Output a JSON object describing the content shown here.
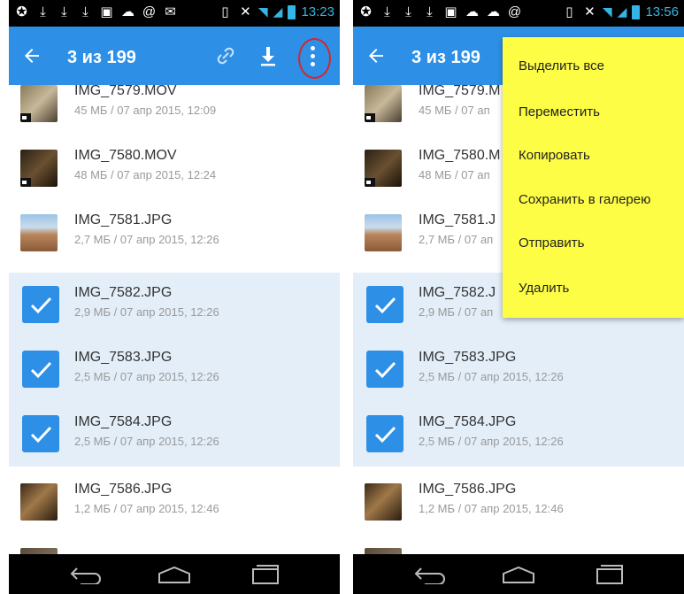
{
  "statusbar": {
    "left": {
      "icons": [
        "settings-icon",
        "download-icon",
        "download-icon",
        "download-icon",
        "image-icon",
        "cloud-icon",
        "at-icon",
        "mail-icon"
      ]
    },
    "right": {
      "icons": [
        "vibrate-icon",
        "no-sound-icon",
        "wifi-icon",
        "signal-icon",
        "battery-icon"
      ]
    },
    "time_left": "13:23",
    "time_right": "13:56"
  },
  "appbar": {
    "counter": "3 из 199",
    "accent": "#2d90e6",
    "highlight_ring": "#d6262a"
  },
  "files": [
    {
      "name": "IMG_7579.MOV",
      "meta": "45 МБ / 07 апр 2015, 12:09",
      "selected": false,
      "video": true
    },
    {
      "name": "IMG_7580.MOV",
      "meta": "48 МБ / 07 апр 2015, 12:24",
      "selected": false,
      "video": true
    },
    {
      "name": "IMG_7581.JPG",
      "meta": "2,7 МБ / 07 апр 2015, 12:26",
      "selected": false,
      "video": false
    },
    {
      "name": "IMG_7582.JPG",
      "meta": "2,9 МБ / 07 апр 2015, 12:26",
      "selected": true,
      "video": false
    },
    {
      "name": "IMG_7583.JPG",
      "meta": "2,5 МБ / 07 апр 2015, 12:26",
      "selected": true,
      "video": false
    },
    {
      "name": "IMG_7584.JPG",
      "meta": "2,5 МБ / 07 апр 2015, 12:26",
      "selected": true,
      "video": false
    },
    {
      "name": "IMG_7586.JPG",
      "meta": "1,2 МБ / 07 апр 2015, 12:46",
      "selected": false,
      "video": false
    }
  ],
  "right_files": [
    {
      "name": "IMG_7579.M",
      "meta": "45 МБ / 07 ап",
      "selected": false,
      "video": true
    },
    {
      "name": "IMG_7580.M",
      "meta": "48 МБ / 07 ап",
      "selected": false,
      "video": true
    },
    {
      "name": "IMG_7581.J",
      "meta": "2,7 МБ / 07 ап",
      "selected": false,
      "video": false
    },
    {
      "name": "IMG_7582.J",
      "meta": "2,9 МБ / 07 ап",
      "selected": true,
      "video": false
    },
    {
      "name": "IMG_7583.JPG",
      "meta": "2,5 МБ / 07 апр 2015, 12:26",
      "selected": true,
      "video": false
    },
    {
      "name": "IMG_7584.JPG",
      "meta": "2,5 МБ / 07 апр 2015, 12:26",
      "selected": true,
      "video": false
    },
    {
      "name": "IMG_7586.JPG",
      "meta": "1,2 МБ / 07 апр 2015, 12:46",
      "selected": false,
      "video": false
    }
  ],
  "menu": {
    "items": [
      "Выделить все",
      "Переместить",
      "Копировать",
      "Сохранить в галерею",
      "Отправить",
      "Удалить"
    ],
    "background": "#fdfd45"
  },
  "navbar": {
    "buttons": [
      "back-nav-icon",
      "home-nav-icon",
      "recents-nav-icon"
    ]
  }
}
